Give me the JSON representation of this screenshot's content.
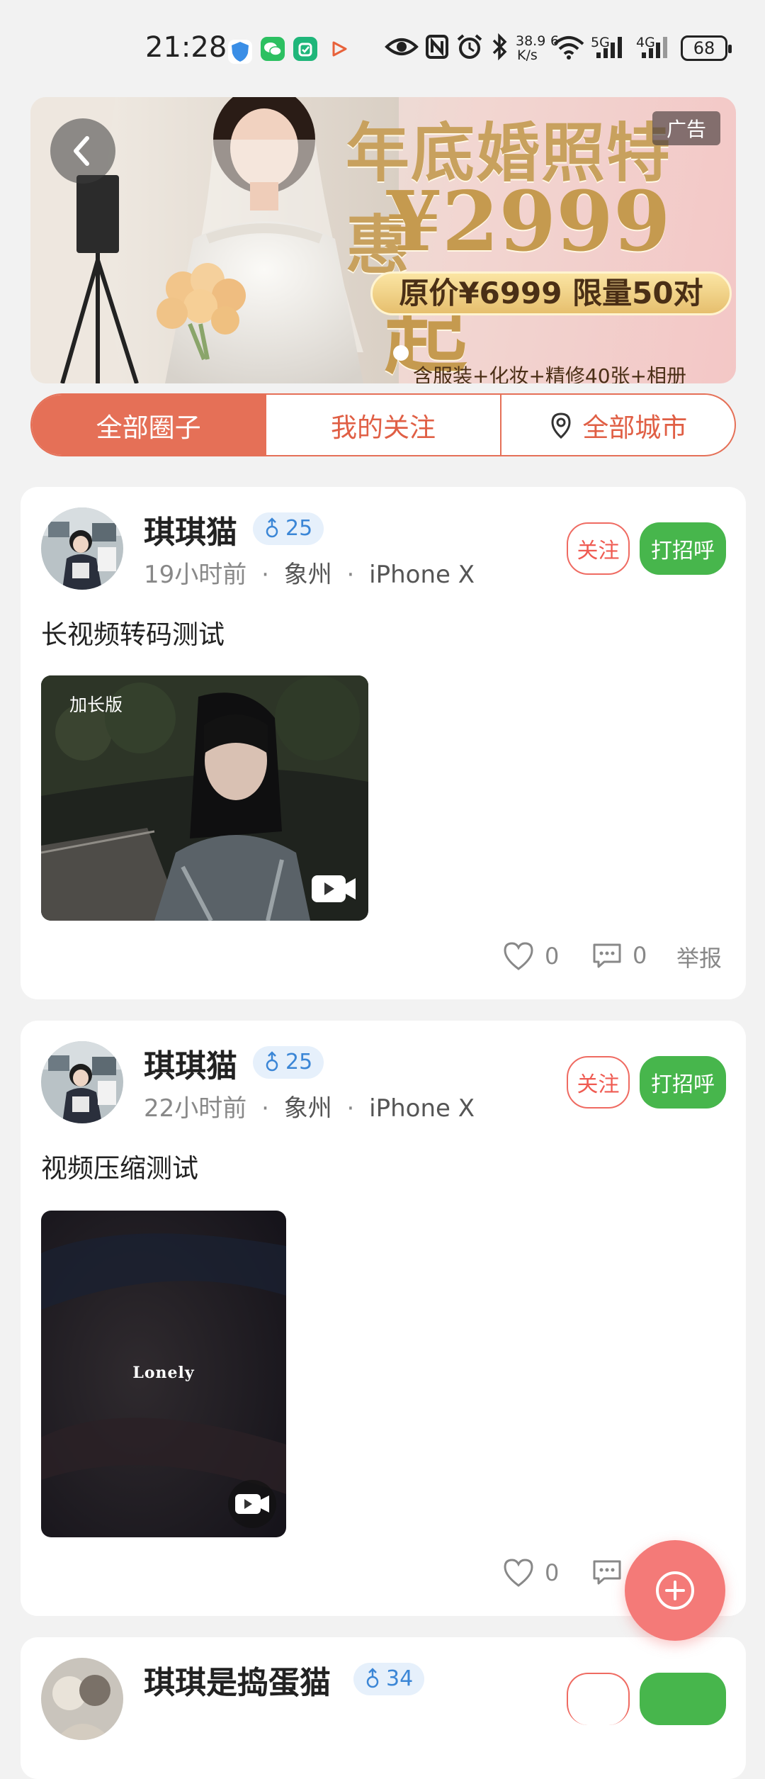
{
  "status_bar": {
    "time": "21:28",
    "network_speed": "38.9",
    "network_speed_unit": "K/s",
    "wifi_label": "6",
    "signal_1_label": "5G",
    "signal_2_label": "4G",
    "battery": "68",
    "icons": [
      "shield-icon",
      "wechat-icon",
      "xiaomi-home-icon",
      "play-icon",
      "eye-icon",
      "nfc-icon",
      "alarm-icon",
      "bluetooth-icon",
      "wifi-icon",
      "signal-icon"
    ]
  },
  "banner": {
    "ad_label": "广告",
    "headline": "年底婚照特惠",
    "price": "¥2999起",
    "price_suffix": "起",
    "original_price": "原价¥6999 限量50对",
    "subline": "含服装+化妆+精修40张+相册"
  },
  "tabs": [
    "全部圈子",
    "我的关注",
    "全部城市"
  ],
  "posts": [
    {
      "username": "琪琪猫",
      "age": "25",
      "time": "19小时前",
      "city": "象州",
      "device": "iPhone X",
      "follow_label": "关注",
      "greet_label": "打招呼",
      "text": "长视频转码测试",
      "video_tag": "加长版",
      "likes": "0",
      "comments": "0",
      "report_label": "举报"
    },
    {
      "username": "琪琪猫",
      "age": "25",
      "time": "22小时前",
      "city": "象州",
      "device": "iPhone X",
      "follow_label": "关注",
      "greet_label": "打招呼",
      "text": "视频压缩测试",
      "video_caption": "Lonely",
      "likes": "0"
    },
    {
      "username": "琪琪是捣蛋猫",
      "age": "34"
    }
  ],
  "colors": {
    "accent": "#e57057",
    "greet_green": "#47b64c",
    "fab": "#f47a78",
    "gender_blue": "#3b86d6"
  }
}
